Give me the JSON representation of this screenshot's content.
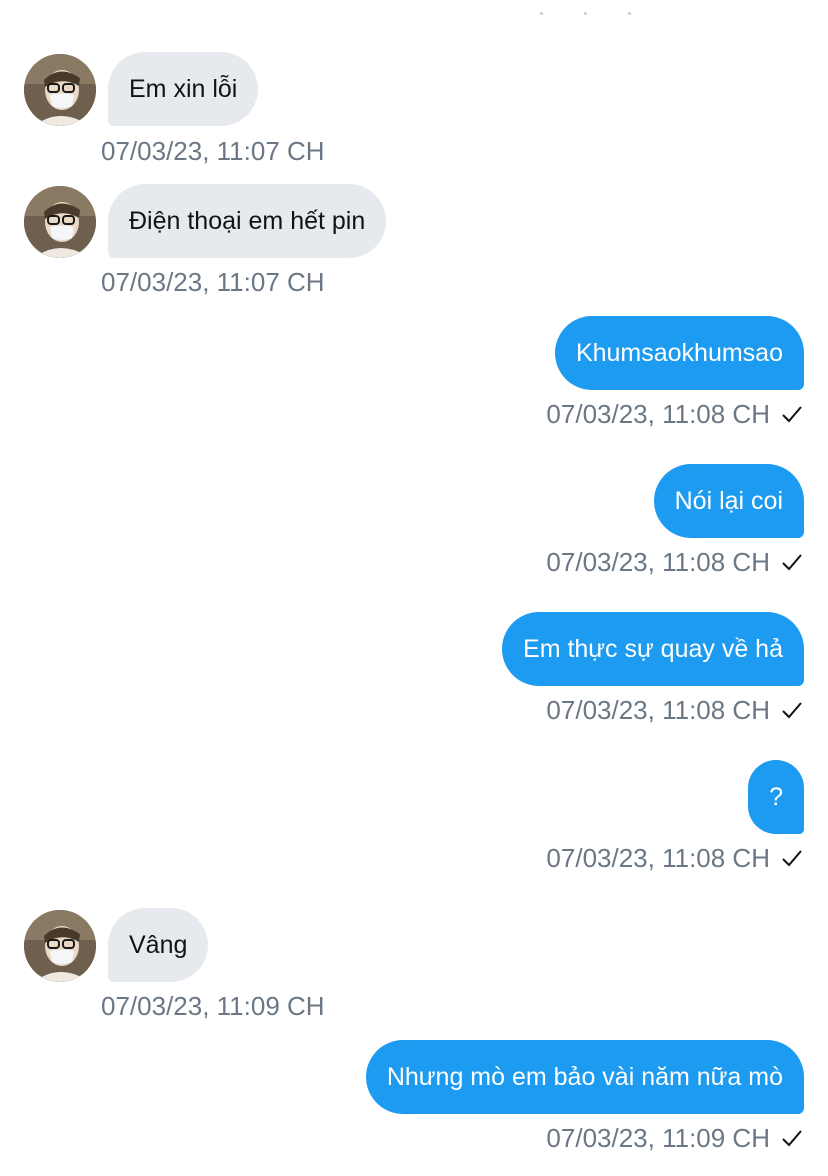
{
  "messages": [
    {
      "direction": "in",
      "text": "Em xin lỗi",
      "time": "07/03/23, 11:07 CH"
    },
    {
      "direction": "in",
      "text": "Điện thoại em hết pin",
      "time": "07/03/23, 11:07 CH"
    },
    {
      "direction": "out",
      "text": "Khumsaokhumsao",
      "time": "07/03/23, 11:08 CH",
      "status_icon": "check-icon"
    },
    {
      "direction": "out",
      "text": "Nói lại coi",
      "time": "07/03/23, 11:08 CH",
      "status_icon": "check-icon"
    },
    {
      "direction": "out",
      "text": "Em thực sự quay về hả",
      "time": "07/03/23, 11:08 CH",
      "status_icon": "check-icon"
    },
    {
      "direction": "out",
      "text": "?",
      "time": "07/03/23, 11:08 CH",
      "status_icon": "check-icon"
    },
    {
      "direction": "in",
      "text": "Vâng",
      "time": "07/03/23, 11:09 CH"
    },
    {
      "direction": "out",
      "text": "Nhưng mò em bảo vài năm nữa mò",
      "time": "07/03/23, 11:09 CH",
      "status_icon": "check-icon"
    }
  ],
  "colors": {
    "outgoing_bubble": "#1d9bf0",
    "incoming_bubble": "#e6e9ee",
    "timestamp": "#6b7785",
    "background": "#ffffff"
  }
}
